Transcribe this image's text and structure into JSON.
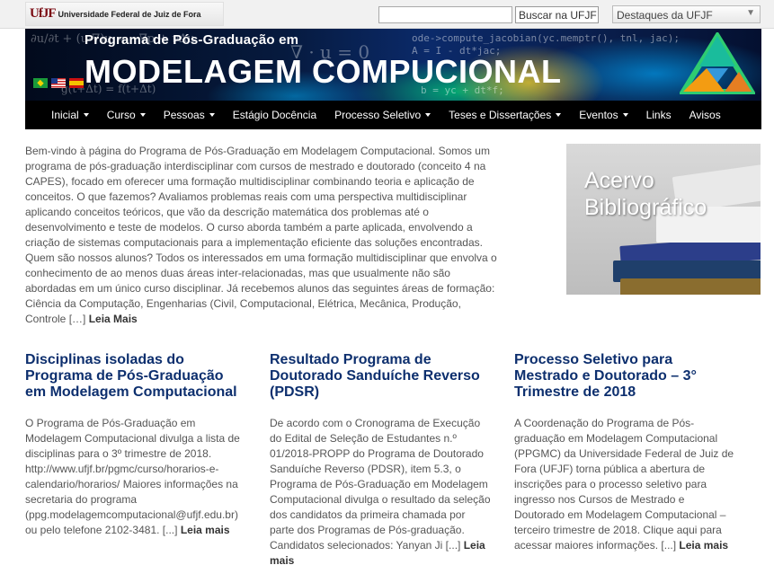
{
  "topbar": {
    "logo_mark": "UfJF",
    "logo_text": "Universidade Federal de Juiz de Fora",
    "search_value": "",
    "search_button": "Buscar na UFJF",
    "destaques_label": "Destaques da UFJF",
    "destaques_arrow": "▼"
  },
  "banner": {
    "subtitle": "Programa de Pós-Graduação em",
    "title": "MODELAGEM COMPUCIONAL",
    "code": "ode->compute_jacobian(yc.memptr(), tnl, jac);\nA = I - dt*jac;",
    "formula_1": "∂u/∂t + (u·∇)u = −∇p + ν∆u",
    "formula_2": "∇ · u = 0",
    "formula_3": "g(t+Δt) = f(t+Δt)",
    "code_2": "b = yc + dt*f;"
  },
  "nav": {
    "items": [
      {
        "label": "Inicial",
        "dropdown": true
      },
      {
        "label": "Curso",
        "dropdown": true
      },
      {
        "label": "Pessoas",
        "dropdown": true
      },
      {
        "label": "Estágio Docência",
        "dropdown": false
      },
      {
        "label": "Processo Seletivo",
        "dropdown": true
      },
      {
        "label": "Teses e Dissertações",
        "dropdown": true
      },
      {
        "label": "Eventos",
        "dropdown": true
      },
      {
        "label": "Links",
        "dropdown": false
      },
      {
        "label": "Avisos",
        "dropdown": false
      }
    ]
  },
  "intro": {
    "text": "Bem-vindo à página do Programa de Pós-Graduação em Modelagem Computacional. Somos um programa de pós-graduação interdisciplinar com cursos de mestrado e doutorado (conceito 4 na CAPES), focado em oferecer uma formação multidisciplinar combinando teoria e aplicação de conceitos.    O que fazemos? Avaliamos problemas reais com uma perspectiva multidisciplinar aplicando conceitos teóricos, que vão da descrição matemática dos problemas até o desenvolvimento e teste de modelos. O curso aborda também a parte aplicada, envolvendo a criação de sistemas computacionais para a implementação eficiente das soluções encontradas. Quem são nossos alunos? Todos os interessados em uma formação multidisciplinar que envolva o conhecimento de ao menos duas áreas inter-relacionadas, mas que usualmente não são abordadas em um único curso disciplinar. Já recebemos alunos das seguintes áreas de formação: Ciência da Computação, Engenharias (Civil, Computacional, Elétrica, Mecânica, Produção, Controle […] ",
    "read_more": "Leia Mais"
  },
  "acervo": {
    "line1": "Acervo",
    "line2": "Bibliográfico"
  },
  "posts": [
    {
      "title": "Disciplinas isoladas do Programa de Pós-Graduação em Modelagem Computacional",
      "body": "O Programa de Pós-Graduação em Modelagem Computacional divulga a lista de disciplinas para o 3º trimestre de 2018. http://www.ufjf.br/pgmc/curso/horarios-e-calendario/horarios/   Maiores informações na secretaria do programa (ppg.modelagemcomputacional@ufjf.edu.br) ou pelo telefone 2102-3481.   [...] ",
      "read_more": "Leia mais"
    },
    {
      "title": "Resultado Programa de Doutorado Sanduíche Reverso (PDSR)",
      "body": "De acordo com o Cronograma de Execução do Edital de Seleção de Estudantes n.º 01/2018-PROPP do Programa de Doutorado Sanduíche Reverso (PDSR), item 5.3, o Programa de Pós-Graduação em Modelagem Computacional divulga o resultado da seleção dos candidatos da primeira chamada por parte dos Programas de Pós-graduação. Candidatos selecionados:  Yanyan Ji [...] ",
      "read_more": "Leia mais"
    },
    {
      "title": "Processo Seletivo para Mestrado e Doutorado – 3° Trimestre de 2018",
      "body": "A Coordenação do Programa de Pós-graduação em Modelagem Computacional (PPGMC) da Universidade Federal de Juiz de Fora (UFJF) torna pública a abertura de inscrições para o processo seletivo para ingresso nos Cursos de Mestrado e Doutorado em Modelagem Computacional – terceiro trimestre de 2018. Clique aqui para acessar maiores informações. [...] ",
      "read_more": "Leia mais"
    }
  ]
}
